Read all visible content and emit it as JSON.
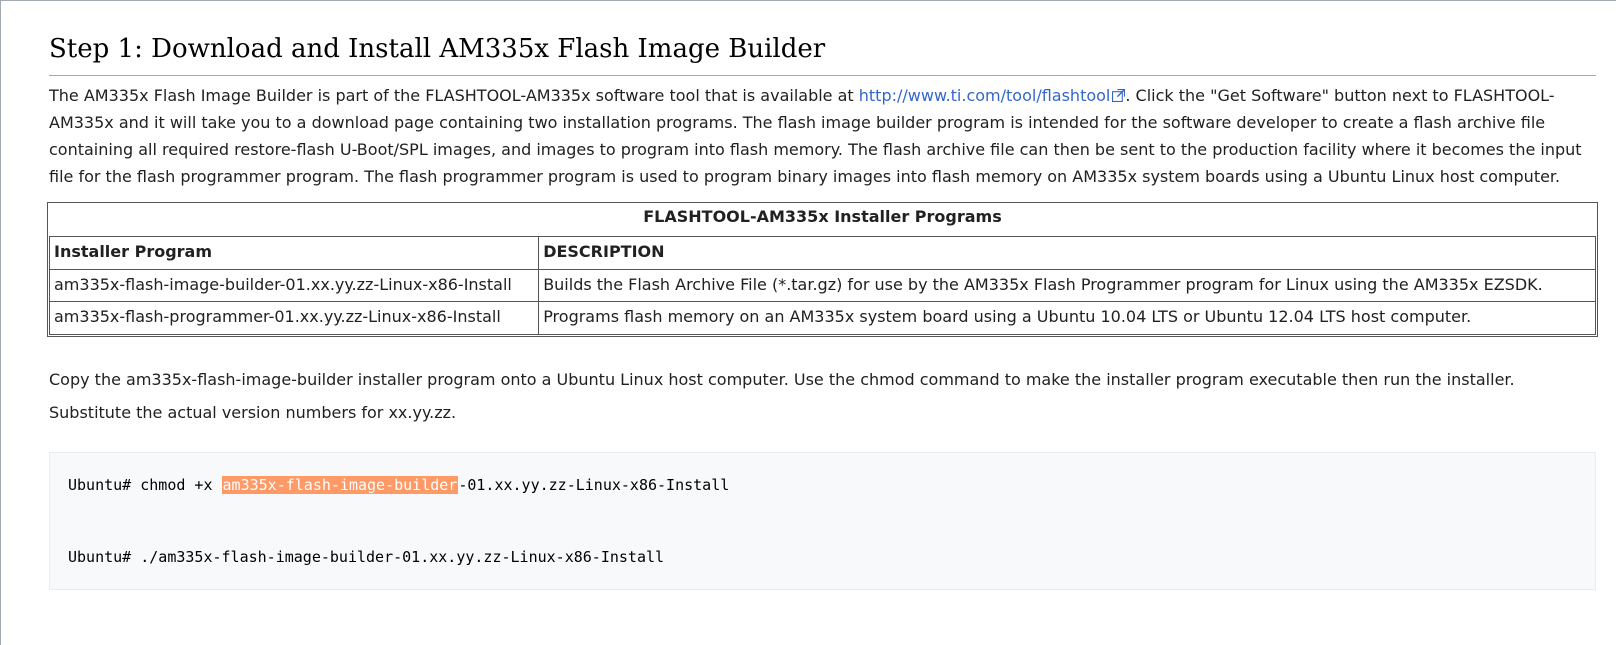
{
  "heading": "Step 1: Download and Install AM335x Flash Image Builder",
  "intro": {
    "before_link": "The AM335x Flash Image Builder is part of the FLASHTOOL-AM335x software tool that is available at ",
    "link_text": "http://www.ti.com/tool/flashtool",
    "after_link": ". Click the \"Get Software\" button next to FLASHTOOL-AM335x and it will take you to a download page containing two installation programs.   The flash image builder program is intended for the software developer to create a flash archive file containing all required restore-flash U-Boot/SPL images, and images to program into flash memory.  The flash archive file can then be sent to the production facility where it becomes the input file for the flash programmer program.  The flash programmer program is used to program binary images into flash memory on AM335x system boards using a Ubuntu Linux host computer."
  },
  "table": {
    "caption": "FLASHTOOL-AM335x Installer Programs",
    "headers": [
      "Installer Program",
      "DESCRIPTION"
    ],
    "rows": [
      {
        "program": " am335x-flash-image-builder-01.xx.yy.zz-Linux-x86-Install",
        "desc": " Builds the Flash Archive File (*.tar.gz) for use by the AM335x Flash Programmer program for Linux using the AM335x EZSDK."
      },
      {
        "program": " am335x-flash-programmer-01.xx.yy.zz-Linux-x86-Install",
        "desc": " Programs flash memory on an AM335x system board using a Ubuntu 10.04 LTS or Ubuntu 12.04 LTS host computer."
      }
    ]
  },
  "after_table": "Copy the am335x-flash-image-builder installer program onto a Ubuntu Linux host computer.   Use the chmod command to make the installer program executable then run the installer.  Substitute the actual version numbers for xx.yy.zz.",
  "code": {
    "line1_pre": "Ubuntu# chmod +x ",
    "line1_hl": "am335x-flash-image-builder",
    "line1_post": "-01.xx.yy.zz-Linux-x86-Install",
    "line2": "Ubuntu# ./am335x-flash-image-builder-01.xx.yy.zz-Linux-x86-Install"
  }
}
